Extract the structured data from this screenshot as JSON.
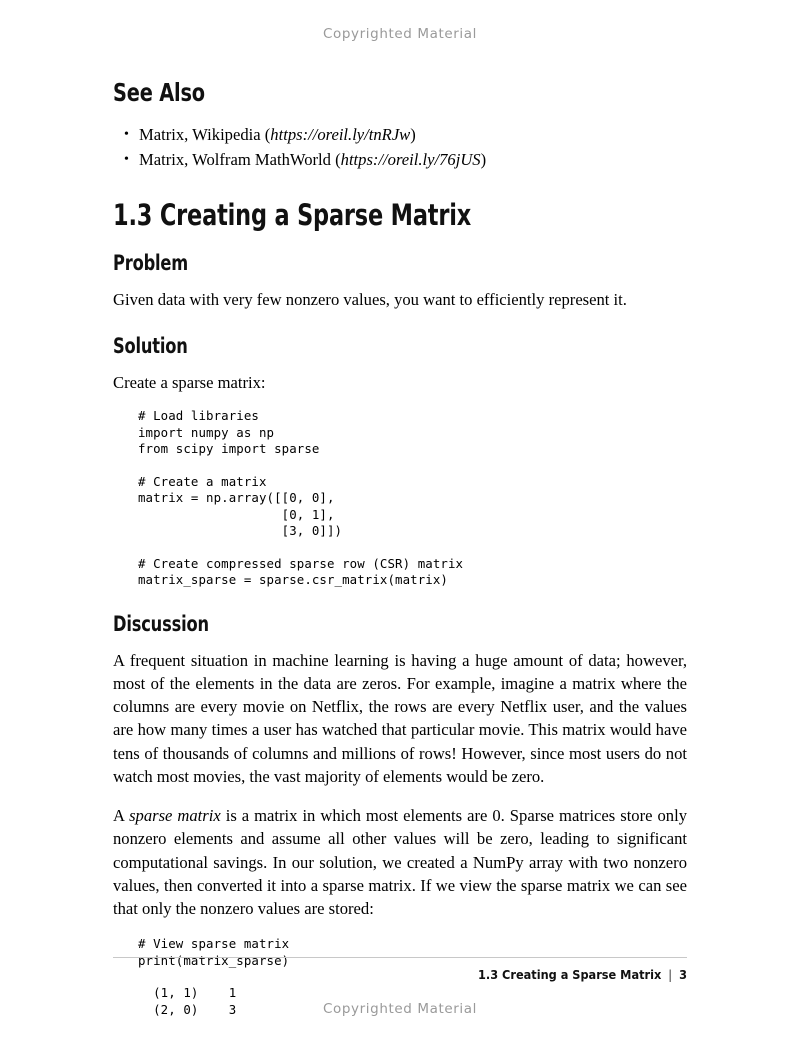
{
  "page": {
    "watermark_top": "Copyrighted Material",
    "watermark_bottom": "Copyrighted Material"
  },
  "see_also": {
    "heading": "See Also",
    "items": [
      {
        "prefix": "Matrix, Wikipedia (",
        "url": "https://oreil.ly/tnRJw",
        "suffix": ")"
      },
      {
        "prefix": "Matrix, Wolfram MathWorld (",
        "url": "https://oreil.ly/76jUS",
        "suffix": ")"
      }
    ]
  },
  "recipe": {
    "title": "1.3 Creating a Sparse Matrix",
    "problem": {
      "heading": "Problem",
      "text": "Given data with very few nonzero values, you want to efficiently represent it."
    },
    "solution": {
      "heading": "Solution",
      "intro": "Create a sparse matrix:",
      "code": "# Load libraries\nimport numpy as np\nfrom scipy import sparse\n\n# Create a matrix\nmatrix = np.array([[0, 0],\n                   [0, 1],\n                   [3, 0]])\n\n# Create compressed sparse row (CSR) matrix\nmatrix_sparse = sparse.csr_matrix(matrix)"
    },
    "discussion": {
      "heading": "Discussion",
      "paragraph_1": "A frequent situation in machine learning is having a huge amount of data; however, most of the elements in the data are zeros. For example, imagine a matrix where the columns are every movie on Netflix, the rows are every Netflix user, and the values are how many times a user has watched that particular movie. This matrix would have tens of thousands of columns and millions of rows! However, since most users do not watch most movies, the vast majority of elements would be zero.",
      "paragraph_2_part_1": "A ",
      "paragraph_2_italic": "sparse matrix",
      "paragraph_2_part_2": " is a matrix in which most elements are 0. Sparse matrices store only nonzero elements and assume all other values will be zero, leading to significant computational savings. In our solution, we created a NumPy array with two nonzero values, then converted it into a sparse matrix. If we view the sparse matrix we can see that only the nonzero values are stored:",
      "code": "# View sparse matrix\nprint(matrix_sparse)\n\n  (1, 1)    1\n  (2, 0)    3"
    }
  },
  "footer": {
    "running_head": "1.3 Creating a Sparse Matrix",
    "separator": "|",
    "page_number": "3"
  }
}
